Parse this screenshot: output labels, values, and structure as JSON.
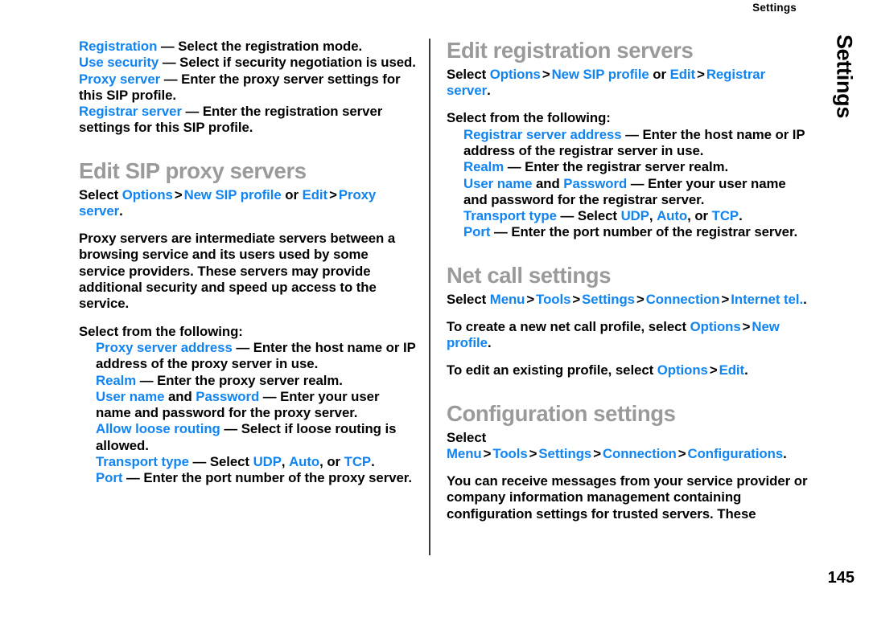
{
  "page": {
    "running_head": "Settings",
    "side_tab": "Settings",
    "folio": "145",
    "accent_color": "#1184f0",
    "heading_color": "#9a9a9a",
    "text_color": "#000000"
  },
  "left_column": {
    "intro_list": {
      "items": [
        {
          "term": "Registration",
          "desc": " — Select the registration mode."
        },
        {
          "term": "Use security",
          "desc": " — Select if security negotiation is used."
        },
        {
          "term": "Proxy server",
          "desc": " — Enter the proxy server settings for this SIP profile."
        },
        {
          "term": "Registrar server",
          "desc": " — Enter the registration server settings for this SIP profile."
        }
      ]
    },
    "section": {
      "heading": "Edit SIP proxy servers",
      "path": {
        "lead": "Select ",
        "p1": "Options",
        "gt1": ">",
        "p2": "New SIP profile",
        "or": " or ",
        "p3": "Edit",
        "gt2": ">",
        "p4": "Proxy server",
        "end": "."
      },
      "body": "Proxy servers are intermediate servers between a browsing service and its users used by some service providers. These servers may provide additional security and speed up access to the service.",
      "select_line": "Select from the following:",
      "items": [
        {
          "term": "Proxy server address",
          "desc": " — Enter the host name or IP address of the proxy server in use."
        },
        {
          "term": "Realm",
          "desc": " — Enter the proxy server realm."
        },
        {
          "term": "User name",
          "mid": " and ",
          "term2": "Password",
          "desc": " — Enter your user name and password for the proxy server."
        },
        {
          "term": "Allow loose routing",
          "desc": " — Select if loose routing is allowed."
        },
        {
          "term": "Transport type",
          "desc_a": " — Select ",
          "opt1": "UDP",
          "opt_sep1": ", ",
          "opt2": "Auto",
          "opt_sep2": ", or ",
          "opt3": "TCP",
          "desc_b": "."
        },
        {
          "term": "Port",
          "desc": " — Enter the port number of the proxy server."
        }
      ]
    }
  },
  "right_column": {
    "section_registration": {
      "heading": "Edit registration servers",
      "path": {
        "lead": "Select ",
        "p1": "Options",
        "gt1": ">",
        "p2": "New SIP profile",
        "or": " or ",
        "p3": "Edit",
        "gt2": ">",
        "p4": "Registrar server",
        "end": "."
      },
      "select_line": "Select from the following:",
      "items": [
        {
          "term": "Registrar server address",
          "desc": " — Enter the host name or IP address of the registrar server in use."
        },
        {
          "term": "Realm",
          "desc": " — Enter the registrar server realm."
        },
        {
          "term": "User name",
          "mid": " and ",
          "term2": "Password",
          "desc": " — Enter your user name and password for the registrar server."
        },
        {
          "term": "Transport type",
          "desc_a": " — Select ",
          "opt1": "UDP",
          "opt_sep1": ", ",
          "opt2": "Auto",
          "opt_sep2": ", or ",
          "opt3": "TCP",
          "desc_b": "."
        },
        {
          "term": "Port",
          "desc": " — Enter the port number of the registrar server."
        }
      ]
    },
    "section_netcall": {
      "heading": "Net call settings",
      "path": {
        "lead": "Select ",
        "p1": "Menu",
        "gt1": ">",
        "p2": "Tools",
        "gt2": ">",
        "p3": "Settings",
        "gt3": ">",
        "p4": "Connection",
        "gt4": ">",
        "p5": "Internet tel.",
        "end": "."
      },
      "create_line": {
        "lead": "To create a new net call profile, select ",
        "p1": "Options",
        "gt1": ">",
        "p2": "New profile",
        "end": "."
      },
      "edit_line": {
        "lead": "To edit an existing profile, select ",
        "p1": "Options",
        "gt1": ">",
        "p2": "Edit",
        "end": "."
      }
    },
    "section_configuration": {
      "heading": "Configuration settings",
      "path": {
        "lead": "Select ",
        "p1": "Menu",
        "gt1": ">",
        "p2": "Tools",
        "gt2": ">",
        "p3": "Settings",
        "gt3": ">",
        "p4": "Connection",
        "gt4": ">",
        "p5": "Configurations",
        "end": "."
      },
      "body": "You can receive messages from your service provider or company information management containing configuration settings for trusted servers. These"
    }
  }
}
